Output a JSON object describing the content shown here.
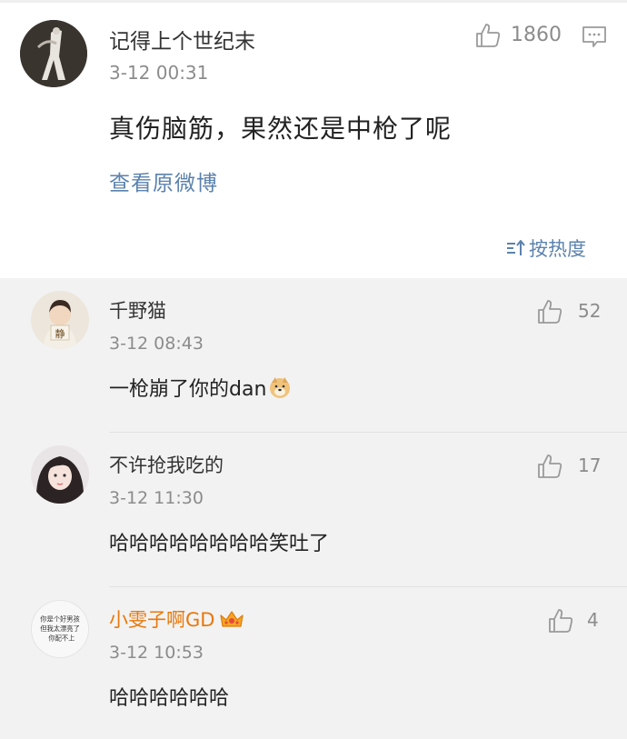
{
  "main_post": {
    "author": "记得上个世纪末",
    "time": "3-12 00:31",
    "like_count": "1860",
    "text": "真伤脑筋，果然还是中枪了呢",
    "view_original_label": "查看原微博",
    "sort_label": "按热度"
  },
  "comments": [
    {
      "author": "千野猫",
      "time": "3-12 08:43",
      "text": "一枪崩了你的dan",
      "like_count": "52",
      "avatar_label": "静"
    },
    {
      "author": "不许抢我吃的",
      "time": "3-12 11:30",
      "text": "哈哈哈哈哈哈哈哈笑吐了",
      "like_count": "17"
    },
    {
      "author": "小雯子啊GD",
      "time": "3-12 10:53",
      "text": "哈哈哈哈哈哈",
      "like_count": "4",
      "avatar_text": [
        "你是个好男孩",
        "但我太漂亮了",
        "你配不上"
      ]
    }
  ],
  "colors": {
    "link_blue": "#5b82ad",
    "vip_orange": "#e8780b",
    "meta_gray": "#8c8c8c"
  },
  "icons": {
    "like": "thumbs-up-icon",
    "comment": "comment-icon",
    "sort": "sort-icon",
    "emoji": "doge-emoji-icon",
    "crown": "vip-crown-icon"
  }
}
